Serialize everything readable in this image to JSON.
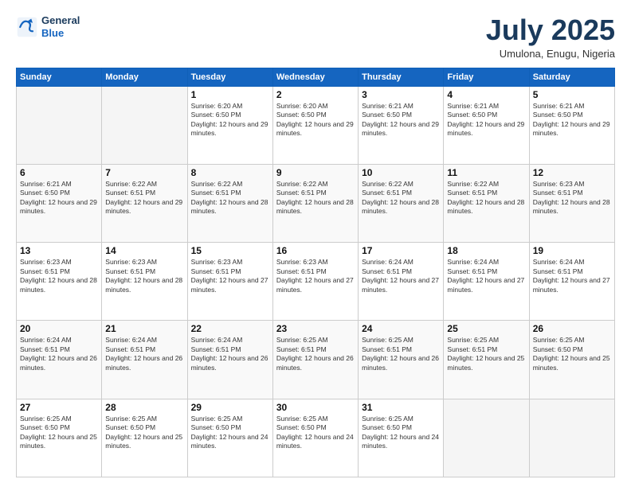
{
  "header": {
    "logo_line1": "General",
    "logo_line2": "Blue",
    "month": "July 2025",
    "location": "Umulona, Enugu, Nigeria"
  },
  "days_of_week": [
    "Sunday",
    "Monday",
    "Tuesday",
    "Wednesday",
    "Thursday",
    "Friday",
    "Saturday"
  ],
  "weeks": [
    {
      "days": [
        {
          "num": "",
          "empty": true
        },
        {
          "num": "",
          "empty": true
        },
        {
          "num": "1",
          "sunrise": "6:20 AM",
          "sunset": "6:50 PM",
          "daylight": "12 hours and 29 minutes."
        },
        {
          "num": "2",
          "sunrise": "6:20 AM",
          "sunset": "6:50 PM",
          "daylight": "12 hours and 29 minutes."
        },
        {
          "num": "3",
          "sunrise": "6:21 AM",
          "sunset": "6:50 PM",
          "daylight": "12 hours and 29 minutes."
        },
        {
          "num": "4",
          "sunrise": "6:21 AM",
          "sunset": "6:50 PM",
          "daylight": "12 hours and 29 minutes."
        },
        {
          "num": "5",
          "sunrise": "6:21 AM",
          "sunset": "6:50 PM",
          "daylight": "12 hours and 29 minutes."
        }
      ]
    },
    {
      "days": [
        {
          "num": "6",
          "sunrise": "6:21 AM",
          "sunset": "6:50 PM",
          "daylight": "12 hours and 29 minutes."
        },
        {
          "num": "7",
          "sunrise": "6:22 AM",
          "sunset": "6:51 PM",
          "daylight": "12 hours and 29 minutes."
        },
        {
          "num": "8",
          "sunrise": "6:22 AM",
          "sunset": "6:51 PM",
          "daylight": "12 hours and 28 minutes."
        },
        {
          "num": "9",
          "sunrise": "6:22 AM",
          "sunset": "6:51 PM",
          "daylight": "12 hours and 28 minutes."
        },
        {
          "num": "10",
          "sunrise": "6:22 AM",
          "sunset": "6:51 PM",
          "daylight": "12 hours and 28 minutes."
        },
        {
          "num": "11",
          "sunrise": "6:22 AM",
          "sunset": "6:51 PM",
          "daylight": "12 hours and 28 minutes."
        },
        {
          "num": "12",
          "sunrise": "6:23 AM",
          "sunset": "6:51 PM",
          "daylight": "12 hours and 28 minutes."
        }
      ]
    },
    {
      "days": [
        {
          "num": "13",
          "sunrise": "6:23 AM",
          "sunset": "6:51 PM",
          "daylight": "12 hours and 28 minutes."
        },
        {
          "num": "14",
          "sunrise": "6:23 AM",
          "sunset": "6:51 PM",
          "daylight": "12 hours and 28 minutes."
        },
        {
          "num": "15",
          "sunrise": "6:23 AM",
          "sunset": "6:51 PM",
          "daylight": "12 hours and 27 minutes."
        },
        {
          "num": "16",
          "sunrise": "6:23 AM",
          "sunset": "6:51 PM",
          "daylight": "12 hours and 27 minutes."
        },
        {
          "num": "17",
          "sunrise": "6:24 AM",
          "sunset": "6:51 PM",
          "daylight": "12 hours and 27 minutes."
        },
        {
          "num": "18",
          "sunrise": "6:24 AM",
          "sunset": "6:51 PM",
          "daylight": "12 hours and 27 minutes."
        },
        {
          "num": "19",
          "sunrise": "6:24 AM",
          "sunset": "6:51 PM",
          "daylight": "12 hours and 27 minutes."
        }
      ]
    },
    {
      "days": [
        {
          "num": "20",
          "sunrise": "6:24 AM",
          "sunset": "6:51 PM",
          "daylight": "12 hours and 26 minutes."
        },
        {
          "num": "21",
          "sunrise": "6:24 AM",
          "sunset": "6:51 PM",
          "daylight": "12 hours and 26 minutes."
        },
        {
          "num": "22",
          "sunrise": "6:24 AM",
          "sunset": "6:51 PM",
          "daylight": "12 hours and 26 minutes."
        },
        {
          "num": "23",
          "sunrise": "6:25 AM",
          "sunset": "6:51 PM",
          "daylight": "12 hours and 26 minutes."
        },
        {
          "num": "24",
          "sunrise": "6:25 AM",
          "sunset": "6:51 PM",
          "daylight": "12 hours and 26 minutes."
        },
        {
          "num": "25",
          "sunrise": "6:25 AM",
          "sunset": "6:51 PM",
          "daylight": "12 hours and 25 minutes."
        },
        {
          "num": "26",
          "sunrise": "6:25 AM",
          "sunset": "6:50 PM",
          "daylight": "12 hours and 25 minutes."
        }
      ]
    },
    {
      "days": [
        {
          "num": "27",
          "sunrise": "6:25 AM",
          "sunset": "6:50 PM",
          "daylight": "12 hours and 25 minutes."
        },
        {
          "num": "28",
          "sunrise": "6:25 AM",
          "sunset": "6:50 PM",
          "daylight": "12 hours and 25 minutes."
        },
        {
          "num": "29",
          "sunrise": "6:25 AM",
          "sunset": "6:50 PM",
          "daylight": "12 hours and 24 minutes."
        },
        {
          "num": "30",
          "sunrise": "6:25 AM",
          "sunset": "6:50 PM",
          "daylight": "12 hours and 24 minutes."
        },
        {
          "num": "31",
          "sunrise": "6:25 AM",
          "sunset": "6:50 PM",
          "daylight": "12 hours and 24 minutes."
        },
        {
          "num": "",
          "empty": true
        },
        {
          "num": "",
          "empty": true
        }
      ]
    }
  ]
}
